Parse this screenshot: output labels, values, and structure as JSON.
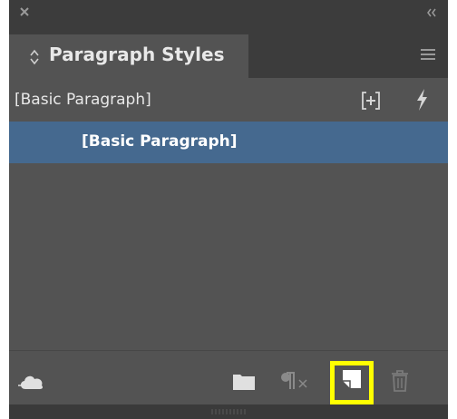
{
  "panel": {
    "tab_label": "Paragraph Styles",
    "header_style": "[Basic Paragraph]",
    "styles": [
      {
        "label": "[Basic Paragraph]",
        "selected": true
      }
    ]
  },
  "icons": {
    "close": "close-icon",
    "collapse": "double-chevron-icon",
    "tab_arrows": "up-down-arrows-icon",
    "panel_menu": "hamburger-menu-icon",
    "new_group": "create-group-icon",
    "quick_apply": "lightning-icon",
    "cc_libraries": "creative-cloud-library-icon",
    "new_folder": "folder-icon",
    "clear_overrides": "pilcrow-clear-icon",
    "new_style": "new-style-icon",
    "delete": "trash-icon"
  },
  "colors": {
    "panel_bg": "#535353",
    "chrome_bg": "#3c3c3c",
    "selection": "#45698f",
    "highlight": "#ffff00"
  }
}
